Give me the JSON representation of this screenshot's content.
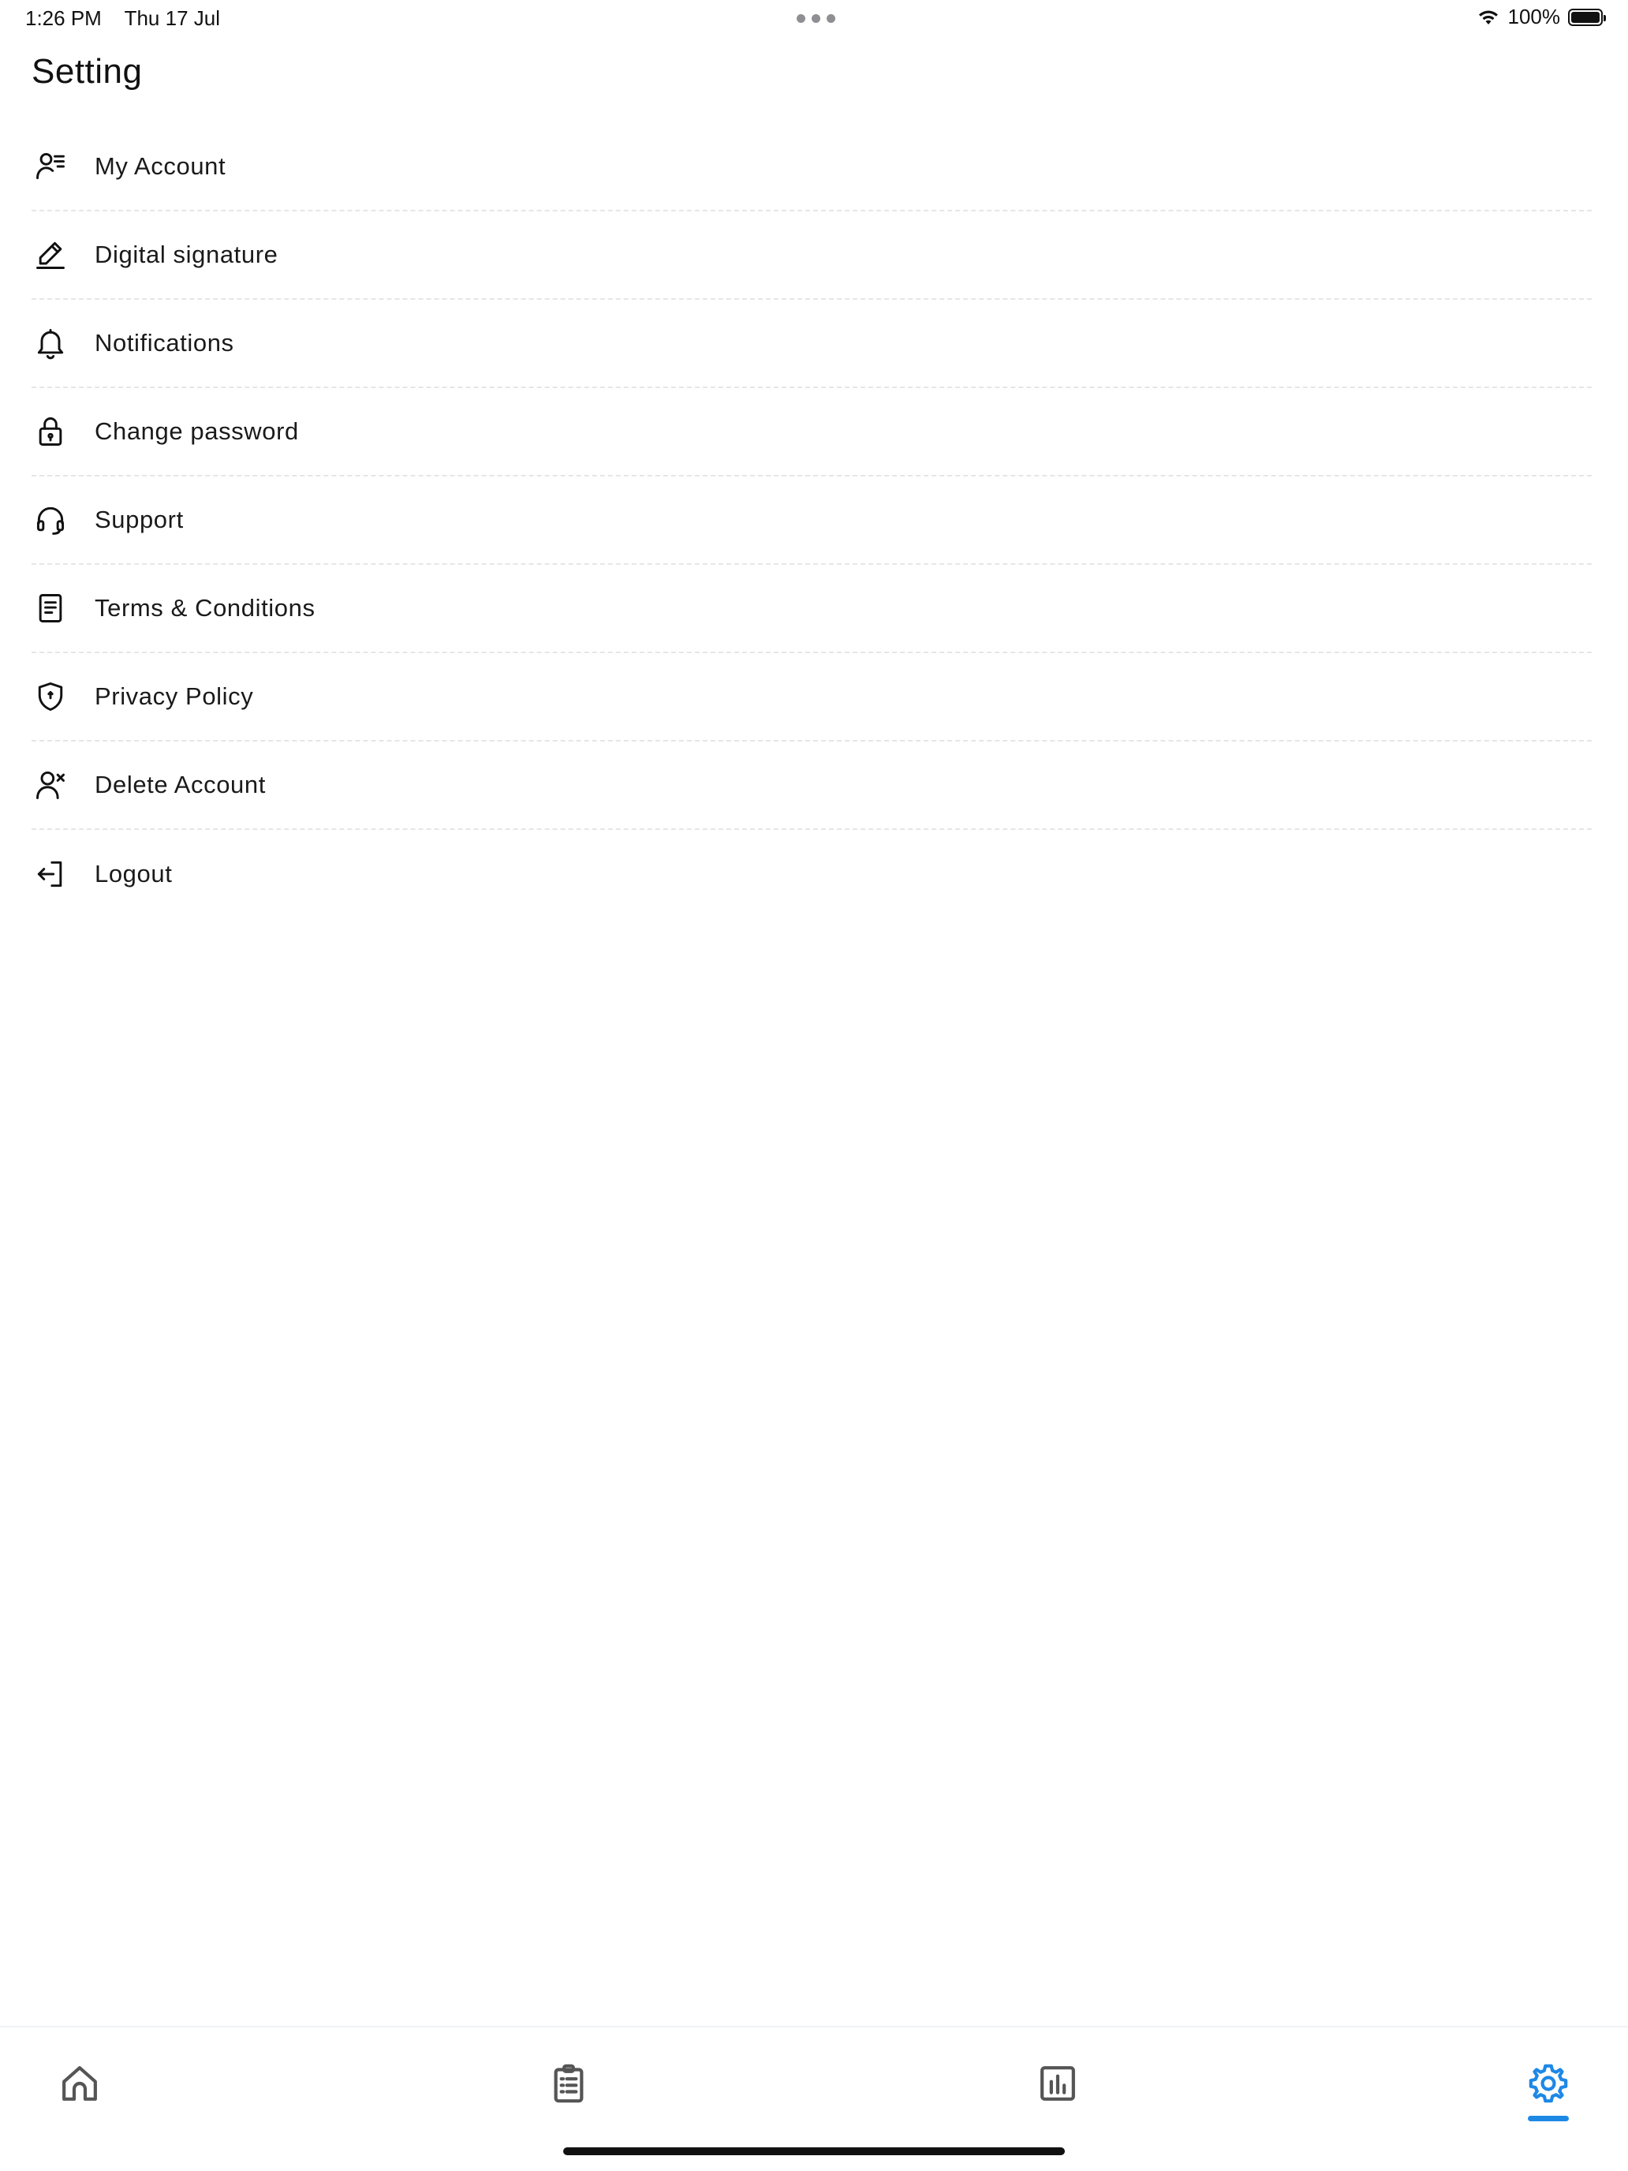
{
  "status_bar": {
    "time": "1:26 PM",
    "date": "Thu 17 Jul",
    "battery": "100%",
    "battery_level": 1.0
  },
  "page": {
    "title": "Setting"
  },
  "menu": {
    "items": [
      {
        "label": "My Account",
        "icon": "account-icon"
      },
      {
        "label": "Digital signature",
        "icon": "pen-icon"
      },
      {
        "label": "Notifications",
        "icon": "bell-icon"
      },
      {
        "label": "Change password",
        "icon": "lock-icon"
      },
      {
        "label": "Support",
        "icon": "headset-icon"
      },
      {
        "label": "Terms & Conditions",
        "icon": "document-icon"
      },
      {
        "label": "Privacy Policy",
        "icon": "shield-icon"
      },
      {
        "label": "Delete Account",
        "icon": "user-remove-icon"
      },
      {
        "label": "Logout",
        "icon": "logout-icon"
      }
    ]
  },
  "tab_bar": {
    "tabs": [
      {
        "icon": "home-icon",
        "active": false
      },
      {
        "icon": "clipboard-list-icon",
        "active": false
      },
      {
        "icon": "bar-chart-icon",
        "active": false
      },
      {
        "icon": "gear-icon",
        "active": true
      }
    ],
    "accent_color": "#1e88e5"
  }
}
